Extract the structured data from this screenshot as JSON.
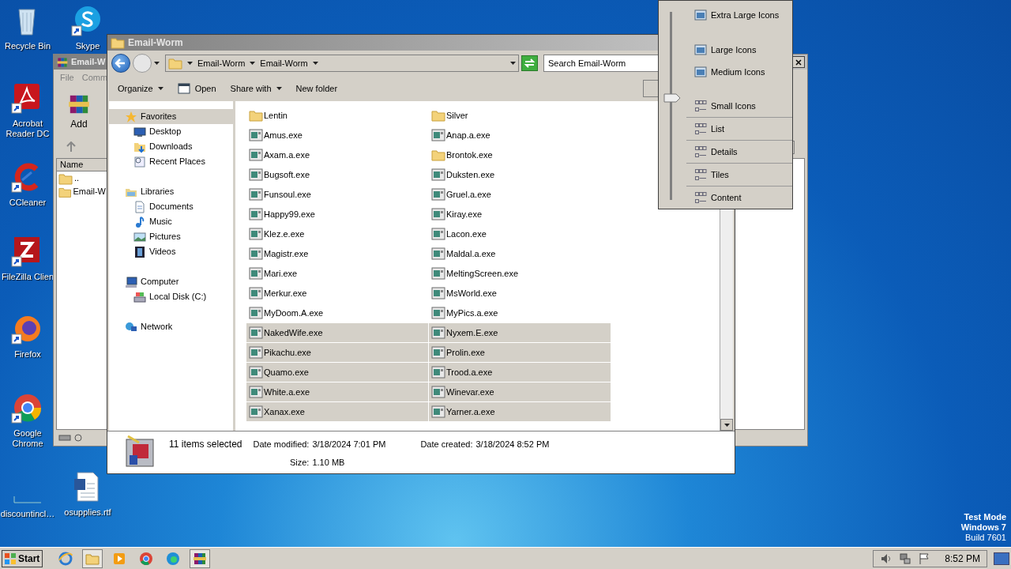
{
  "desktop": {
    "icons": [
      {
        "label": "Recycle Bin",
        "kind": "recycle",
        "shortcut": false
      },
      {
        "label": "Acrobat Reader DC",
        "kind": "acrobat",
        "shortcut": true
      },
      {
        "label": "CCleaner",
        "kind": "ccleaner",
        "shortcut": true
      },
      {
        "label": "FileZilla Clien",
        "kind": "filezilla",
        "shortcut": true
      },
      {
        "label": "Firefox",
        "kind": "firefox",
        "shortcut": true
      },
      {
        "label": "Google Chrome",
        "kind": "chrome",
        "shortcut": true
      },
      {
        "label": "discountincl…",
        "kind": "blank",
        "shortcut": false
      },
      {
        "label": "Skype",
        "kind": "skype",
        "shortcut": true
      },
      {
        "label": "osupplies.rtf",
        "kind": "word",
        "shortcut": false
      }
    ],
    "system_notice": [
      "Test Mode",
      "Windows 7",
      "Build 7601"
    ]
  },
  "background_window": {
    "title": "Email-W",
    "menu": [
      "File",
      "Comm"
    ],
    "toolbar_button": "Add",
    "column": "Name",
    "rows": [
      "..",
      "Email-W"
    ]
  },
  "explorer": {
    "title": "Email-Worm",
    "breadcrumbs": [
      "Email-Worm",
      "Email-Worm"
    ],
    "search": {
      "placeholder": "Search Email-Worm"
    },
    "toolbar": [
      {
        "label": "Organize",
        "kind": "menu"
      },
      {
        "label": "Open",
        "kind": "open"
      },
      {
        "label": "Share with",
        "kind": "menu"
      },
      {
        "label": "New folder",
        "kind": "plain"
      }
    ],
    "nav_pane": [
      {
        "label": "Favorites",
        "kind": "star",
        "selected": true,
        "children": [
          {
            "label": "Desktop",
            "kind": "desktop",
            "selected": false
          },
          {
            "label": "Downloads",
            "kind": "downloads",
            "selected": false
          },
          {
            "label": "Recent Places",
            "kind": "recent",
            "selected": false
          }
        ]
      },
      {
        "label": "Libraries",
        "kind": "libraries",
        "selected": false,
        "children": [
          {
            "label": "Documents",
            "kind": "document",
            "selected": false
          },
          {
            "label": "Music",
            "kind": "music",
            "selected": false
          },
          {
            "label": "Pictures",
            "kind": "pictures",
            "selected": false
          },
          {
            "label": "Videos",
            "kind": "videos",
            "selected": false
          }
        ]
      },
      {
        "label": "Computer",
        "kind": "computer",
        "selected": false,
        "children": [
          {
            "label": "Local Disk (C:)",
            "kind": "disk",
            "selected": false
          }
        ]
      },
      {
        "label": "Network",
        "kind": "network",
        "selected": false
      }
    ],
    "files": [
      {
        "name": "Lentin",
        "kind": "folder",
        "selected": false
      },
      {
        "name": "Silver",
        "kind": "folder",
        "selected": false
      },
      {
        "name": "Amus.exe",
        "kind": "program",
        "selected": false
      },
      {
        "name": "Anap.a.exe",
        "kind": "program",
        "selected": false
      },
      {
        "name": "Axam.a.exe",
        "kind": "program",
        "selected": false
      },
      {
        "name": "Brontok.exe",
        "kind": "folder",
        "selected": false
      },
      {
        "name": "Bugsoft.exe",
        "kind": "program",
        "selected": false
      },
      {
        "name": "Duksten.exe",
        "kind": "program",
        "selected": false
      },
      {
        "name": "Funsoul.exe",
        "kind": "program",
        "selected": false
      },
      {
        "name": "Gruel.a.exe",
        "kind": "program",
        "selected": false
      },
      {
        "name": "Happy99.exe",
        "kind": "program",
        "selected": false
      },
      {
        "name": "Kiray.exe",
        "kind": "program",
        "selected": false
      },
      {
        "name": "Klez.e.exe",
        "kind": "program",
        "selected": false
      },
      {
        "name": "Lacon.exe",
        "kind": "program",
        "selected": false
      },
      {
        "name": "Magistr.exe",
        "kind": "program",
        "selected": false
      },
      {
        "name": "Maldal.a.exe",
        "kind": "program",
        "selected": false
      },
      {
        "name": "Mari.exe",
        "kind": "program",
        "selected": false
      },
      {
        "name": "MeltingScreen.exe",
        "kind": "program",
        "selected": false
      },
      {
        "name": "Merkur.exe",
        "kind": "program",
        "selected": false
      },
      {
        "name": "MsWorld.exe",
        "kind": "program",
        "selected": false
      },
      {
        "name": "MyDoom.A.exe",
        "kind": "program",
        "selected": false
      },
      {
        "name": "MyPics.a.exe",
        "kind": "program",
        "selected": false
      },
      {
        "name": "NakedWife.exe",
        "kind": "program",
        "selected": true
      },
      {
        "name": "Nyxem.E.exe",
        "kind": "program",
        "selected": true
      },
      {
        "name": "Pikachu.exe",
        "kind": "program",
        "selected": true
      },
      {
        "name": "Prolin.exe",
        "kind": "program",
        "selected": true
      },
      {
        "name": "Quamo.exe",
        "kind": "program",
        "selected": true
      },
      {
        "name": "Trood.a.exe",
        "kind": "program",
        "selected": true
      },
      {
        "name": "White.a.exe",
        "kind": "program",
        "selected": true
      },
      {
        "name": "Winevar.exe",
        "kind": "program",
        "selected": true
      },
      {
        "name": "Xanax.exe",
        "kind": "program",
        "selected": true
      },
      {
        "name": "Yarner.a.exe",
        "kind": "program",
        "selected": true
      }
    ],
    "details": {
      "summary": "11 items selected",
      "fields": [
        {
          "label": "Date modified:",
          "value": "3/18/2024 7:01 PM"
        },
        {
          "label": "Date created:",
          "value": "3/18/2024 8:52 PM"
        },
        {
          "label": "Size:",
          "value": "1.10 MB"
        }
      ]
    }
  },
  "view_menu": {
    "level": 0.54,
    "items": [
      {
        "label": "Extra Large Icons",
        "kind": "size"
      },
      {
        "label": "Large Icons",
        "kind": "size"
      },
      {
        "label": "Medium Icons",
        "kind": "size"
      },
      {
        "label": "Small Icons",
        "kind": "size"
      },
      {
        "label": "List",
        "kind": "layout"
      },
      {
        "label": "Details",
        "kind": "layout"
      },
      {
        "label": "Tiles",
        "kind": "layout"
      },
      {
        "label": "Content",
        "kind": "layout"
      }
    ]
  },
  "taskbar": {
    "start": "Start",
    "items": [
      {
        "kind": "ie",
        "active": false
      },
      {
        "kind": "explorer",
        "active": true
      },
      {
        "kind": "media",
        "active": false
      },
      {
        "kind": "chrome",
        "active": false
      },
      {
        "kind": "edge",
        "active": false
      },
      {
        "kind": "winrar",
        "active": true
      }
    ],
    "clock": "8:52 PM"
  }
}
